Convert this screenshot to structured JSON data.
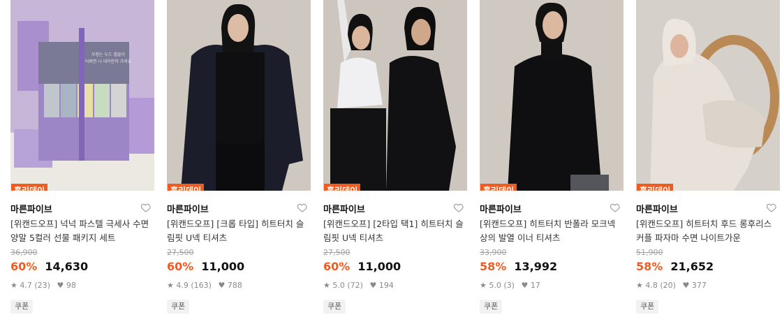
{
  "products": [
    {
      "badge": "홀리데이",
      "brand": "마른파이브",
      "title": "[위캔드오프] 넉넉 파스텔 극세사 수면양말 5컬러 선물 패키지 세트",
      "original_price": "36,900",
      "discount": "60%",
      "price": "14,630",
      "rating": "4.7",
      "reviews": "(23)",
      "likes": "98",
      "coupon": "쿠폰",
      "image": "gift-box-socks",
      "box_text_1": "부정는 두드 셀클이",
      "box_text_2": "어쩌면 나 데허란하 가져요"
    },
    {
      "badge": "홀리데이",
      "brand": "마른파이브",
      "title": "[위캔드오프] [크롭 타입] 히트터치 슬림핏 U넥 티셔츠",
      "original_price": "27,500",
      "discount": "60%",
      "price": "11,000",
      "rating": "4.9",
      "reviews": "(163)",
      "likes": "788",
      "coupon": "쿠폰",
      "image": "model-crop-top-cardigan"
    },
    {
      "badge": "홀리데이",
      "brand": "마른파이브",
      "title": "[위캔드오프] [2타입 택1] 히트터치 슬림핏 U넥 티셔츠",
      "original_price": "27,500",
      "discount": "60%",
      "price": "11,000",
      "rating": "5.0",
      "reviews": "(72)",
      "likes": "194",
      "coupon": "쿠폰",
      "image": "two-models-white-black"
    },
    {
      "badge": "홀리데이",
      "brand": "마른파이브",
      "title": "[위캔드오프] 히트터치 반폴라 모크넥 상의 발열 이너 티셔츠",
      "original_price": "33,900",
      "discount": "58%",
      "price": "13,992",
      "rating": "5.0",
      "reviews": "(3)",
      "likes": "17",
      "coupon": "쿠폰",
      "image": "model-mock-neck"
    },
    {
      "badge": "홀리데이",
      "brand": "마른파이브",
      "title": "[위캔드오프] 히트터치 후드 롱후리스 커플 파자마 수면 나이트가운",
      "original_price": "51,900",
      "discount": "58%",
      "price": "21,652",
      "rating": "4.8",
      "reviews": "(20)",
      "likes": "377",
      "coupon": "쿠폰",
      "image": "model-fleece-robe-chair"
    }
  ],
  "colors": {
    "accent": "#f25a1e",
    "muted": "#8a8a8a",
    "strike": "#a0a0a0"
  }
}
